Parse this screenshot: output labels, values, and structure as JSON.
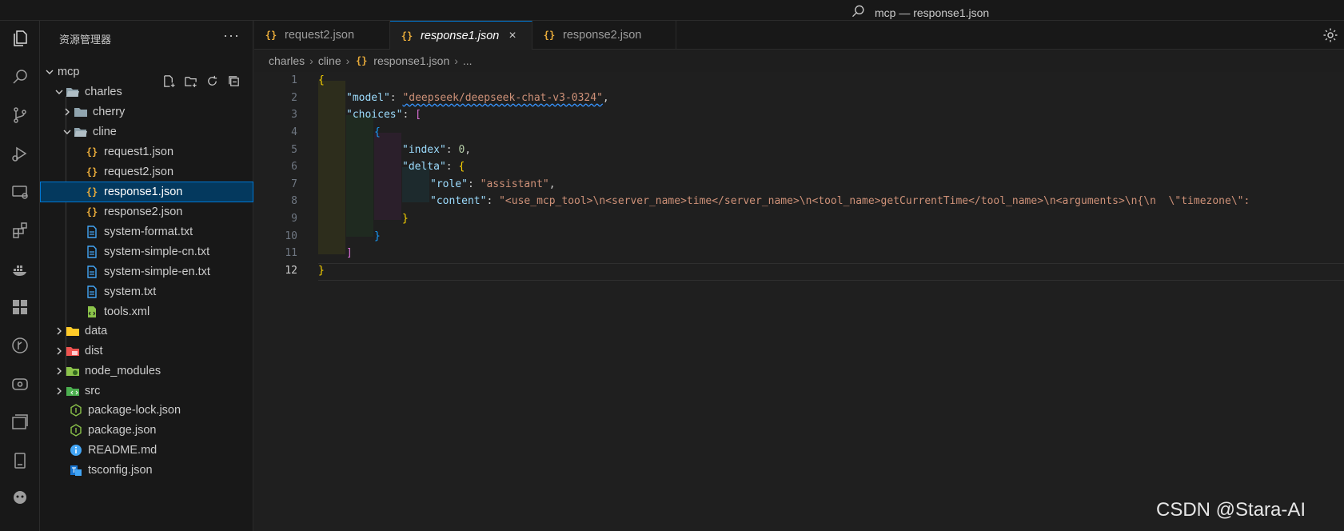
{
  "titlebar": {
    "title": "mcp — response1.json"
  },
  "activity_bar": {
    "items": [
      {
        "icon": "files-icon",
        "active": true
      },
      {
        "icon": "search-icon"
      },
      {
        "icon": "source-control-icon"
      },
      {
        "icon": "run-debug-icon"
      },
      {
        "icon": "remote-explorer-icon"
      },
      {
        "icon": "extensions-icon"
      },
      {
        "icon": "docker-icon"
      },
      {
        "icon": "grid-icon"
      },
      {
        "icon": "git-graph-icon"
      },
      {
        "icon": "database-icon"
      },
      {
        "icon": "window-icon"
      },
      {
        "icon": "tablet-icon"
      },
      {
        "icon": "cline-icon"
      }
    ]
  },
  "sidebar": {
    "title": "资源管理器",
    "more": "···",
    "tree": [
      {
        "label": "mcp",
        "type": "root"
      },
      {
        "label": "charles",
        "type": "folder-open"
      },
      {
        "label": "cherry",
        "type": "folder"
      },
      {
        "label": "cline",
        "type": "folder-open"
      },
      {
        "label": "request1.json",
        "type": "json"
      },
      {
        "label": "request2.json",
        "type": "json"
      },
      {
        "label": "response1.json",
        "type": "json",
        "selected": true
      },
      {
        "label": "response2.json",
        "type": "json"
      },
      {
        "label": "system-format.txt",
        "type": "txt"
      },
      {
        "label": "system-simple-cn.txt",
        "type": "txt"
      },
      {
        "label": "system-simple-en.txt",
        "type": "txt"
      },
      {
        "label": "system.txt",
        "type": "txt"
      },
      {
        "label": "tools.xml",
        "type": "xml"
      },
      {
        "label": "data",
        "type": "folder-data"
      },
      {
        "label": "dist",
        "type": "folder-dist"
      },
      {
        "label": "node_modules",
        "type": "folder-node"
      },
      {
        "label": "src",
        "type": "folder-src"
      },
      {
        "label": "package-lock.json",
        "type": "node"
      },
      {
        "label": "package.json",
        "type": "node"
      },
      {
        "label": "README.md",
        "type": "info"
      },
      {
        "label": "tsconfig.json",
        "type": "ts"
      }
    ]
  },
  "tabs": [
    {
      "label": "request2.json"
    },
    {
      "label": "response1.json",
      "active": true,
      "close": "×"
    },
    {
      "label": "response2.json"
    }
  ],
  "breadcrumb": [
    "charles",
    "cline",
    "response1.json",
    "..."
  ],
  "editor": {
    "current_line": 12,
    "line_numbers": [
      "1",
      "2",
      "3",
      "4",
      "5",
      "6",
      "7",
      "8",
      "9",
      "10",
      "11",
      "12"
    ],
    "lines": [
      {
        "indent": 0,
        "tokens": [
          {
            "c": "b1",
            "t": "{"
          }
        ]
      },
      {
        "indent": 1,
        "tokens": [
          {
            "c": "k",
            "t": "\"model\""
          },
          {
            "c": "p",
            "t": ": "
          },
          {
            "c": "s",
            "t": "\"deepseek/deepseek-chat-v3-0324\""
          },
          {
            "c": "p",
            "t": ","
          }
        ]
      },
      {
        "indent": 1,
        "tokens": [
          {
            "c": "k",
            "t": "\"choices\""
          },
          {
            "c": "p",
            "t": ": "
          },
          {
            "c": "b2",
            "t": "["
          }
        ]
      },
      {
        "indent": 2,
        "tokens": [
          {
            "c": "b3",
            "t": "{"
          }
        ]
      },
      {
        "indent": 3,
        "tokens": [
          {
            "c": "k",
            "t": "\"index\""
          },
          {
            "c": "p",
            "t": ": "
          },
          {
            "c": "n",
            "t": "0"
          },
          {
            "c": "p",
            "t": ","
          }
        ]
      },
      {
        "indent": 3,
        "tokens": [
          {
            "c": "k",
            "t": "\"delta\""
          },
          {
            "c": "p",
            "t": ": "
          },
          {
            "c": "b1",
            "t": "{"
          }
        ]
      },
      {
        "indent": 4,
        "tokens": [
          {
            "c": "k",
            "t": "\"role\""
          },
          {
            "c": "p",
            "t": ": "
          },
          {
            "c": "s",
            "t": "\"assistant\""
          },
          {
            "c": "p",
            "t": ","
          }
        ]
      },
      {
        "indent": 4,
        "tokens": [
          {
            "c": "k",
            "t": "\"content\""
          },
          {
            "c": "p",
            "t": ": "
          },
          {
            "c": "s",
            "t": "\"<use_mcp_tool>\\n<server_name>time</server_name>\\n<tool_name>getCurrentTime</tool_name>\\n<arguments>\\n{\\n  \\\"timezone\\\":"
          }
        ]
      },
      {
        "indent": 3,
        "tokens": [
          {
            "c": "b1",
            "t": "}"
          }
        ]
      },
      {
        "indent": 2,
        "tokens": [
          {
            "c": "b3",
            "t": "}"
          }
        ]
      },
      {
        "indent": 1,
        "tokens": [
          {
            "c": "b2",
            "t": "]"
          }
        ]
      },
      {
        "indent": 0,
        "tokens": [
          {
            "c": "b1",
            "t": "}"
          }
        ]
      }
    ]
  },
  "watermark": "CSDN @Stara-AI",
  "colors": {
    "accent": "#0078d4",
    "selection": "#04395e",
    "json_icon": "#e8ab3a",
    "string": "#ce9178",
    "key": "#9cdcfe"
  }
}
